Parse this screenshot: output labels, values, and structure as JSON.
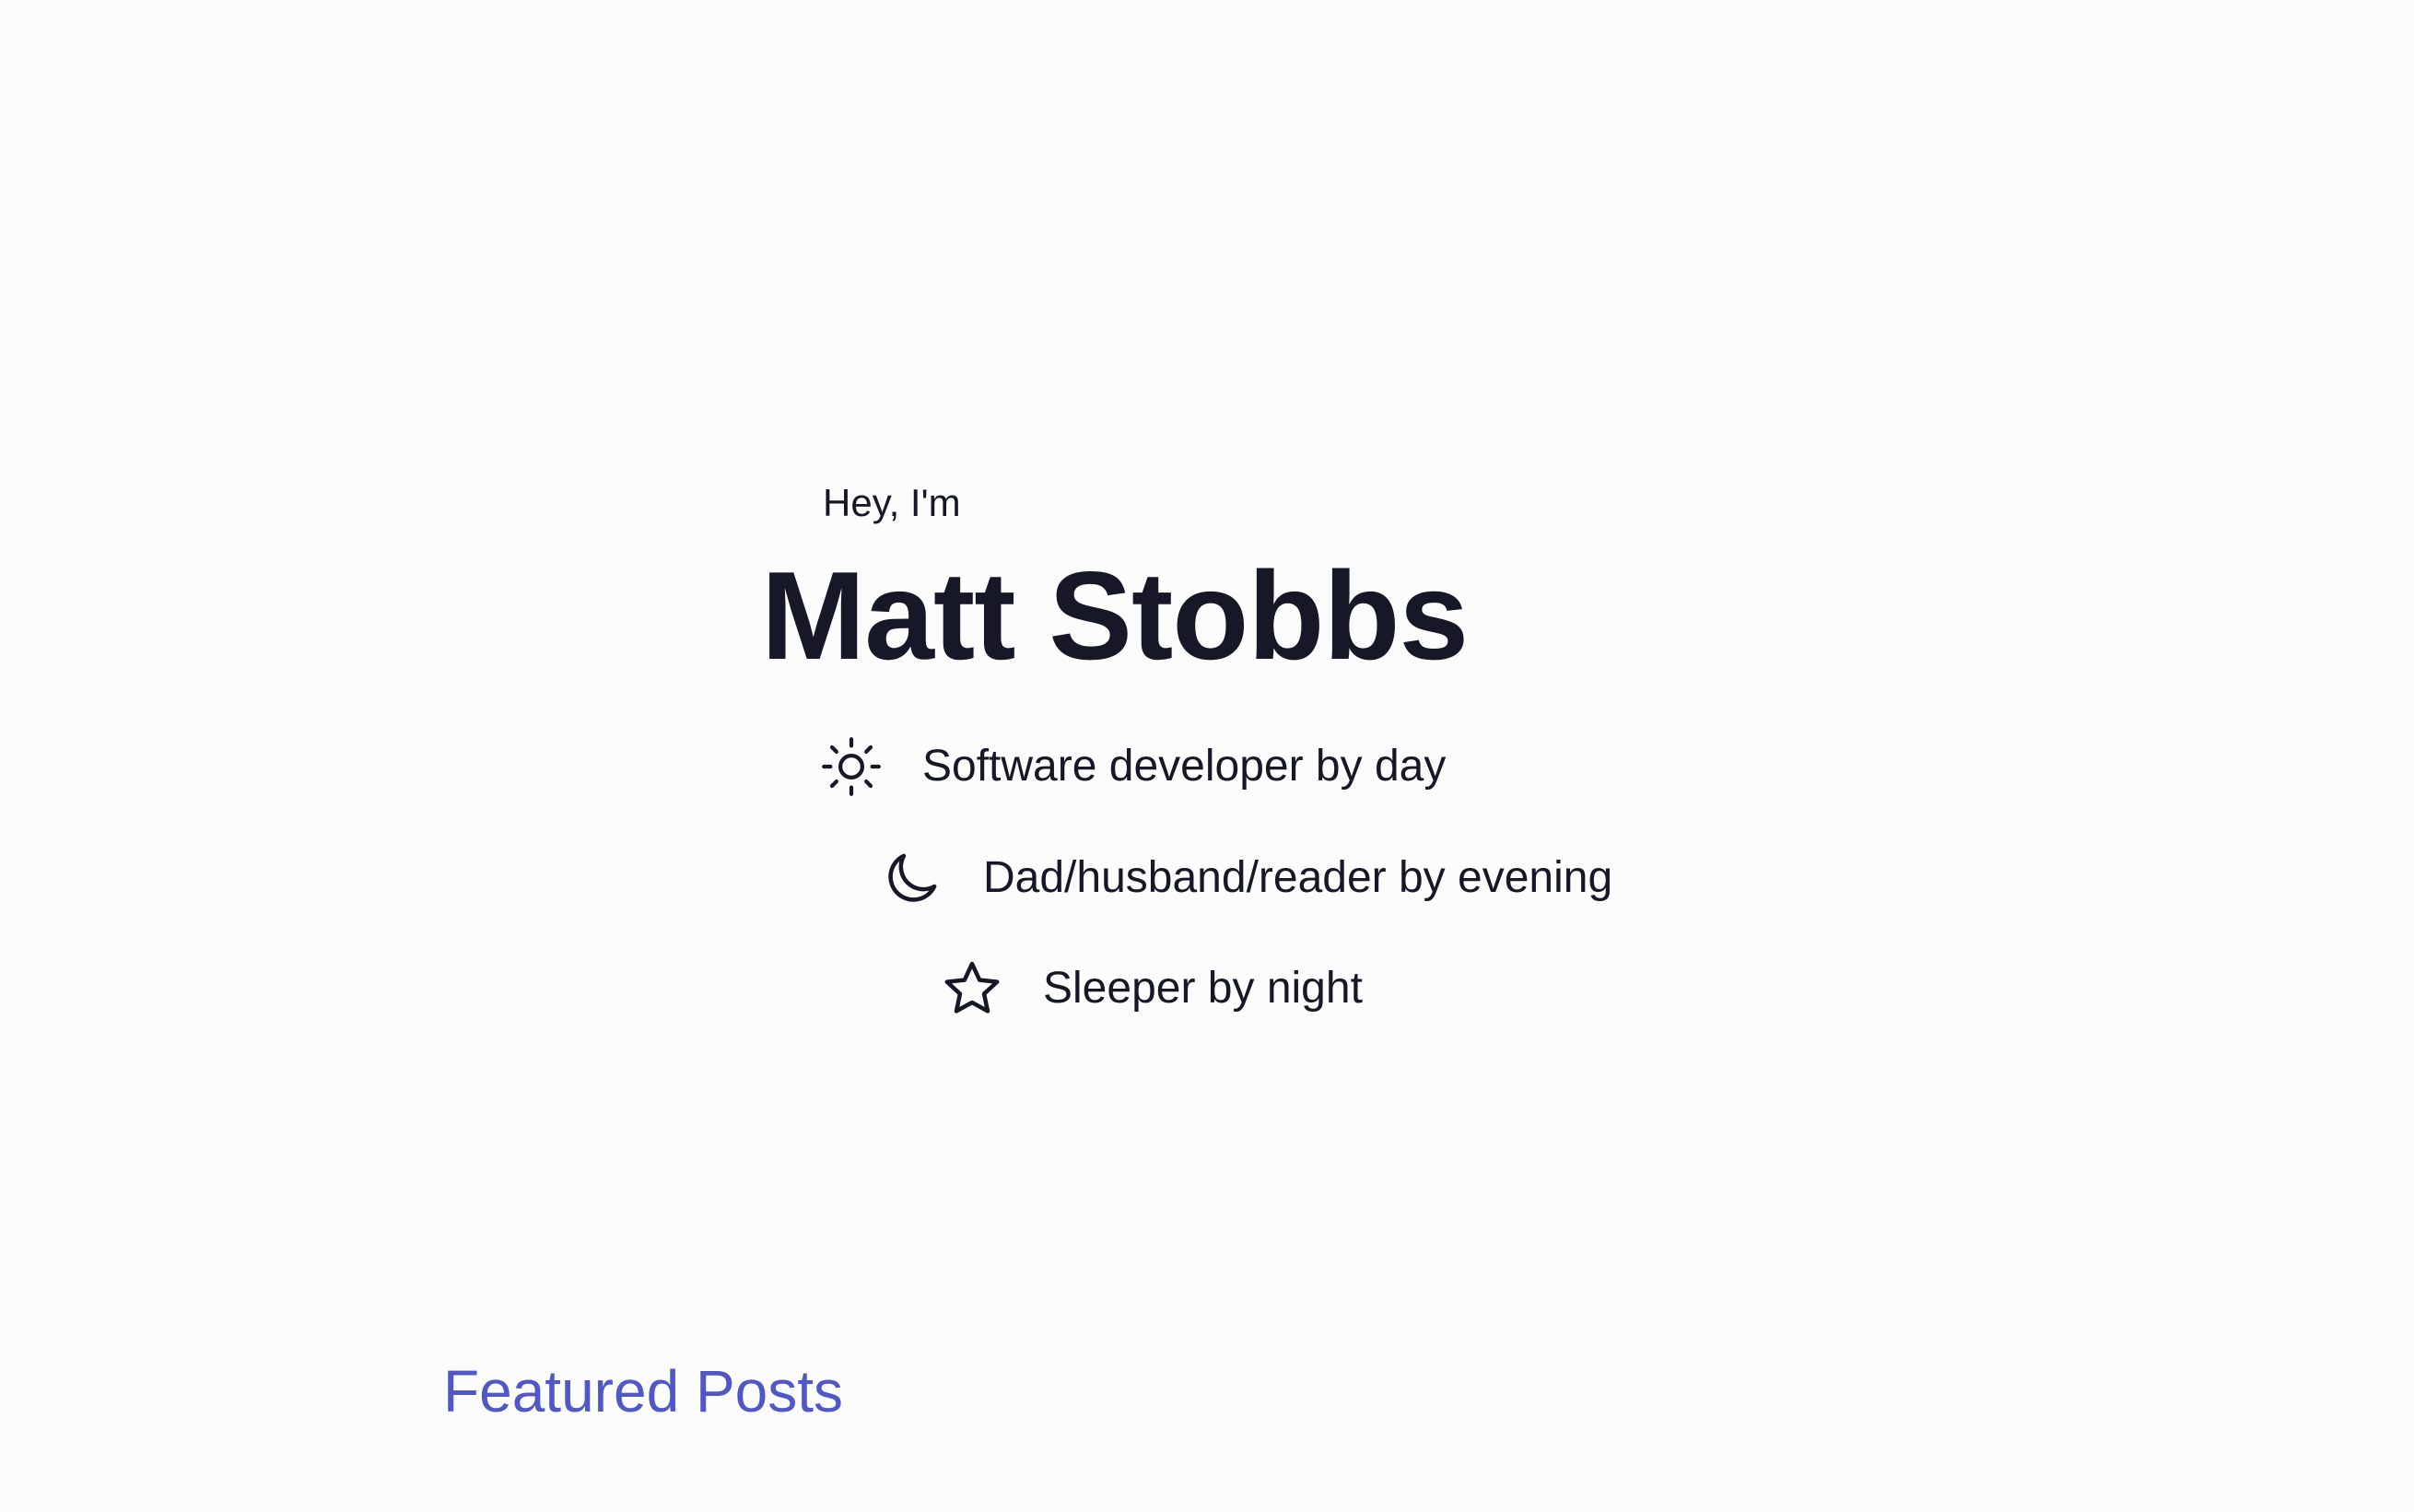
{
  "hero": {
    "greeting": "Hey, I'm",
    "name": "Matt Stobbs",
    "taglines": [
      {
        "icon": "sun-icon",
        "label": "Software developer by day"
      },
      {
        "icon": "moon-icon",
        "label": "Dad/husband/reader by evening"
      },
      {
        "icon": "star-icon",
        "label": "Sleeper by night"
      }
    ]
  },
  "featured": {
    "title": "Featured Posts"
  },
  "colors": {
    "background": "#fdfcfc",
    "text": "#161827",
    "accent": "#4f58c6"
  }
}
